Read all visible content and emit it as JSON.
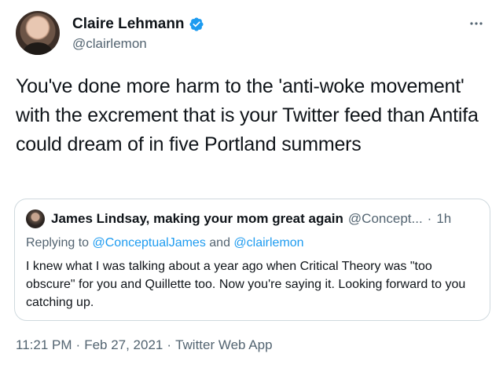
{
  "author": {
    "display_name": "Claire Lehmann",
    "handle": "@clairlemon",
    "verified": true,
    "avatar_icon": "profile-photo",
    "verified_icon": "verified-badge-icon"
  },
  "more_icon": "more-horizontal-icon",
  "tweet": {
    "text": "You've done more harm to the 'anti-woke movement' with the excrement that is your Twitter feed than Antifa could dream of in five Portland summers"
  },
  "quoted_tweet": {
    "display_name": "James Lindsay, making your mom great again",
    "handle": "@Concept...",
    "dot": "·",
    "time": "1h",
    "replying_prefix": "Replying to",
    "reply_mentions": [
      "@ConceptualJames",
      "@clairlemon"
    ],
    "reply_conjunction": "and",
    "text": "I knew what I was talking about a year ago when Critical Theory was \"too obscure\" for you and Quillette too. Now you're saying it. Looking forward to you catching up."
  },
  "footer": {
    "time": "11:21 PM",
    "separator": "·",
    "date": "Feb 27, 2021",
    "source": "Twitter Web App"
  },
  "colors": {
    "text_primary": "#0f1419",
    "text_secondary": "#536471",
    "accent": "#1d9bf0",
    "border": "#cfd9de"
  }
}
